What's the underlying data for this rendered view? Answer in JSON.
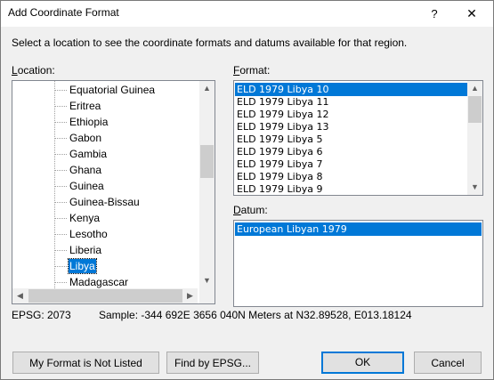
{
  "window": {
    "title": "Add Coordinate Format",
    "help_glyph": "?",
    "close_glyph": "✕"
  },
  "description": "Select a location to see the coordinate formats and datums available for that region.",
  "location": {
    "label_accel": "L",
    "label_rest": "ocation:",
    "items": [
      {
        "label": "Equatorial Guinea",
        "selected": false
      },
      {
        "label": "Eritrea",
        "selected": false
      },
      {
        "label": "Ethiopia",
        "selected": false
      },
      {
        "label": "Gabon",
        "selected": false
      },
      {
        "label": "Gambia",
        "selected": false
      },
      {
        "label": "Ghana",
        "selected": false
      },
      {
        "label": "Guinea",
        "selected": false
      },
      {
        "label": "Guinea-Bissau",
        "selected": false
      },
      {
        "label": "Kenya",
        "selected": false
      },
      {
        "label": "Lesotho",
        "selected": false
      },
      {
        "label": "Liberia",
        "selected": false
      },
      {
        "label": "Libya",
        "selected": true
      },
      {
        "label": "Madagascar",
        "selected": false
      }
    ]
  },
  "format": {
    "label_accel": "F",
    "label_rest": "ormat:",
    "items": [
      {
        "label": "ELD 1979 Libya 10",
        "selected": true
      },
      {
        "label": "ELD 1979 Libya 11",
        "selected": false
      },
      {
        "label": "ELD 1979 Libya 12",
        "selected": false
      },
      {
        "label": "ELD 1979 Libya 13",
        "selected": false
      },
      {
        "label": "ELD 1979 Libya 5",
        "selected": false
      },
      {
        "label": "ELD 1979 Libya 6",
        "selected": false
      },
      {
        "label": "ELD 1979 Libya 7",
        "selected": false
      },
      {
        "label": "ELD 1979 Libya 8",
        "selected": false
      },
      {
        "label": "ELD 1979 Libya 9",
        "selected": false
      }
    ]
  },
  "datum": {
    "label_accel": "D",
    "label_rest": "atum:",
    "items": [
      {
        "label": "European Libyan 1979",
        "selected": true
      }
    ]
  },
  "status": {
    "epsg": "EPSG: 2073",
    "sample": "Sample: -344 692E  3656 040N Meters at N32.89528, E013.18124"
  },
  "buttons": {
    "not_listed": "My Format is Not Listed",
    "find_epsg": "Find by EPSG...",
    "ok": "OK",
    "cancel": "Cancel"
  },
  "icons": {
    "arrow_up": "▲",
    "arrow_down": "▼",
    "arrow_left": "◀",
    "arrow_right": "▶"
  }
}
